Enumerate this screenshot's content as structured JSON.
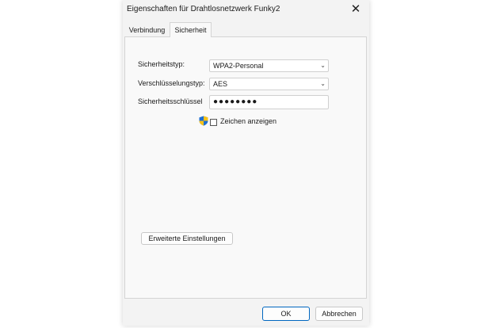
{
  "window": {
    "title": "Eigenschaften für Drahtlosnetzwerk Funky2",
    "close_glyph": "✕"
  },
  "tabs": [
    {
      "label": "Verbindung",
      "active": false
    },
    {
      "label": "Sicherheit",
      "active": true
    }
  ],
  "security": {
    "type_label": "Sicherheitstyp:",
    "type_value": "WPA2-Personal",
    "encryption_label": "Verschlüsselungstyp:",
    "encryption_value": "AES",
    "key_label": "Sicherheitsschlüssel",
    "key_value": "●●●●●●●●",
    "show_chars_label": "Zeichen anzeigen",
    "show_chars_checked": false
  },
  "advanced_button": "Erweiterte Einstellungen",
  "footer": {
    "ok_label": "OK",
    "cancel_label": "Abbrechen"
  },
  "colors": {
    "accent": "#0067c0",
    "dialog_bg": "#f3f3f3",
    "panel_bg": "#f9f9f9"
  },
  "icons": {
    "shield": "uac-shield-icon",
    "dropdown": "chevron-down-icon"
  }
}
